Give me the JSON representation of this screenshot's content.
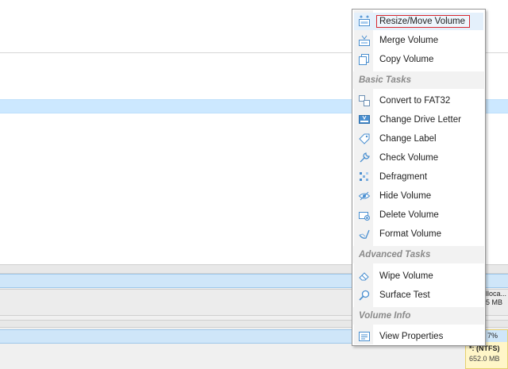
{
  "menu": {
    "top_items": [
      {
        "label": "Resize/Move Volume",
        "icon": "resize-move-icon",
        "highlighted": true
      },
      {
        "label": "Merge Volume",
        "icon": "merge-icon"
      },
      {
        "label": "Copy Volume",
        "icon": "copy-icon"
      }
    ],
    "basic_header": "Basic Tasks",
    "basic_items": [
      {
        "label": "Convert to FAT32",
        "icon": "convert-icon"
      },
      {
        "label": "Change Drive Letter",
        "icon": "drive-letter-icon"
      },
      {
        "label": "Change Label",
        "icon": "label-tag-icon"
      },
      {
        "label": "Check Volume",
        "icon": "wrench-icon"
      },
      {
        "label": "Defragment",
        "icon": "defragment-icon"
      },
      {
        "label": "Hide Volume",
        "icon": "hide-eye-icon"
      },
      {
        "label": "Delete Volume",
        "icon": "delete-icon"
      },
      {
        "label": "Format Volume",
        "icon": "format-brush-icon"
      }
    ],
    "advanced_header": "Advanced Tasks",
    "advanced_items": [
      {
        "label": "Wipe Volume",
        "icon": "eraser-icon"
      },
      {
        "label": "Surface Test",
        "icon": "magnifier-icon"
      }
    ],
    "info_header": "Volume Info",
    "info_items": [
      {
        "label": "View Properties",
        "icon": "properties-icon"
      }
    ]
  },
  "disk_map": {
    "unallocated_label": "lloca...",
    "unallocated_size": "5 MB",
    "partition_usage": "7%",
    "partition_name": "*: (NTFS)",
    "partition_size": "652.0 MB"
  },
  "colors": {
    "highlight_outline": "#d7282f",
    "selection": "#cce8ff",
    "icon_blue": "#4a8fd0"
  }
}
